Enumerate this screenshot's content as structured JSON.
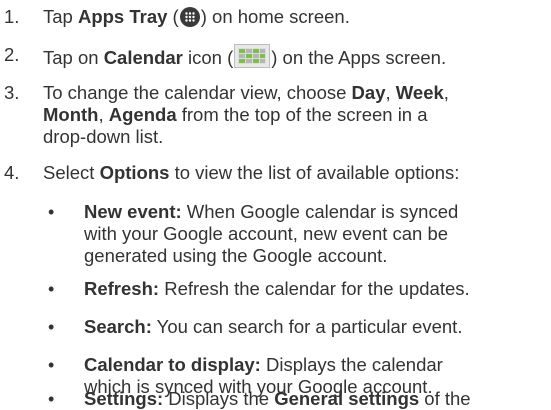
{
  "steps": [
    {
      "number": "1.",
      "before": "Tap ",
      "bold": "Apps Tray",
      "mid": " (",
      "icon": "apps-tray-icon",
      "after": ") on home screen."
    },
    {
      "number": "2.",
      "before": "Tap on ",
      "bold": "Calendar",
      "mid": " icon (",
      "icon": "calendar-icon",
      "after": ") on the Apps screen."
    },
    {
      "number": "3.",
      "line1_a": "To change the calendar view, choose ",
      "day": "Day",
      "comma1": ", ",
      "week": "Week",
      "comma2": ",",
      "month": "Month",
      "comma3": ", ",
      "agenda": "Agenda",
      "line2_end": " from the top of the screen in a",
      "line3": "drop-down list."
    },
    {
      "number": "4.",
      "before": "Select ",
      "bold": "Options",
      "after": " to view the list of available options:"
    }
  ],
  "options": [
    {
      "label": "New event:",
      "line1": " When Google calendar is synced",
      "line2": "with your Google account, new event can be",
      "line3": "generated using the Google account."
    },
    {
      "label": "Refresh:",
      "line1": " Refresh the calendar for the updates."
    },
    {
      "label": "Search:",
      "line1": " You can search for a particular event."
    },
    {
      "label": "Calendar to display:",
      "line1": " Displays the calendar",
      "line2": "which is synced with your Google account."
    },
    {
      "label": "Settings:",
      "line1": " Displays the ",
      "bold2": "General settings",
      "line1_end": " of the"
    }
  ],
  "bullet_char": "•",
  "colors": {
    "text": "#333333",
    "apps_icon_bg": "#3a3a3a",
    "calendar_icon_green": "#7cc242"
  }
}
